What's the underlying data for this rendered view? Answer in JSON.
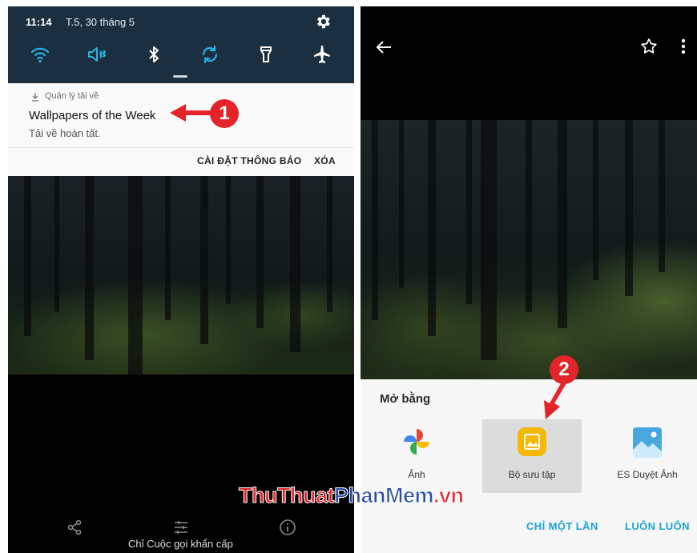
{
  "left_screen": {
    "status": {
      "time": "11:14",
      "date": "T.5, 30 tháng 5"
    },
    "quick_settings": [
      "wifi-icon",
      "sound-icon",
      "bluetooth-icon",
      "sync-icon",
      "flashlight-icon",
      "airplane-icon"
    ],
    "notification": {
      "app_name": "Quản lý tải về",
      "title": "Wallpapers of the Week",
      "subtitle": "Tải về hoàn tất.",
      "actions": {
        "settings": "CÀI ĐẶT THÔNG BÁO",
        "clear": "XÓA"
      }
    },
    "marker": "1",
    "nav": {
      "emergency": "Chỉ Cuộc gọi khẩn cấp"
    }
  },
  "right_screen": {
    "sheet": {
      "title": "Mở bằng",
      "apps": [
        {
          "label": "Ảnh"
        },
        {
          "label": "Bộ sưu tập"
        },
        {
          "label": "ES Duyệt Ảnh"
        }
      ],
      "actions": {
        "once": "CHỈ MỘT LẦN",
        "always": "LUÔN LUÔN"
      }
    },
    "marker": "2"
  },
  "watermark": {
    "part1": "ThuThuat",
    "part2": "PhanMem",
    "part3": ".vn"
  },
  "colors": {
    "shade": "#1c2f3f",
    "accent": "#1aa3d9",
    "marker": "#e4242b"
  }
}
